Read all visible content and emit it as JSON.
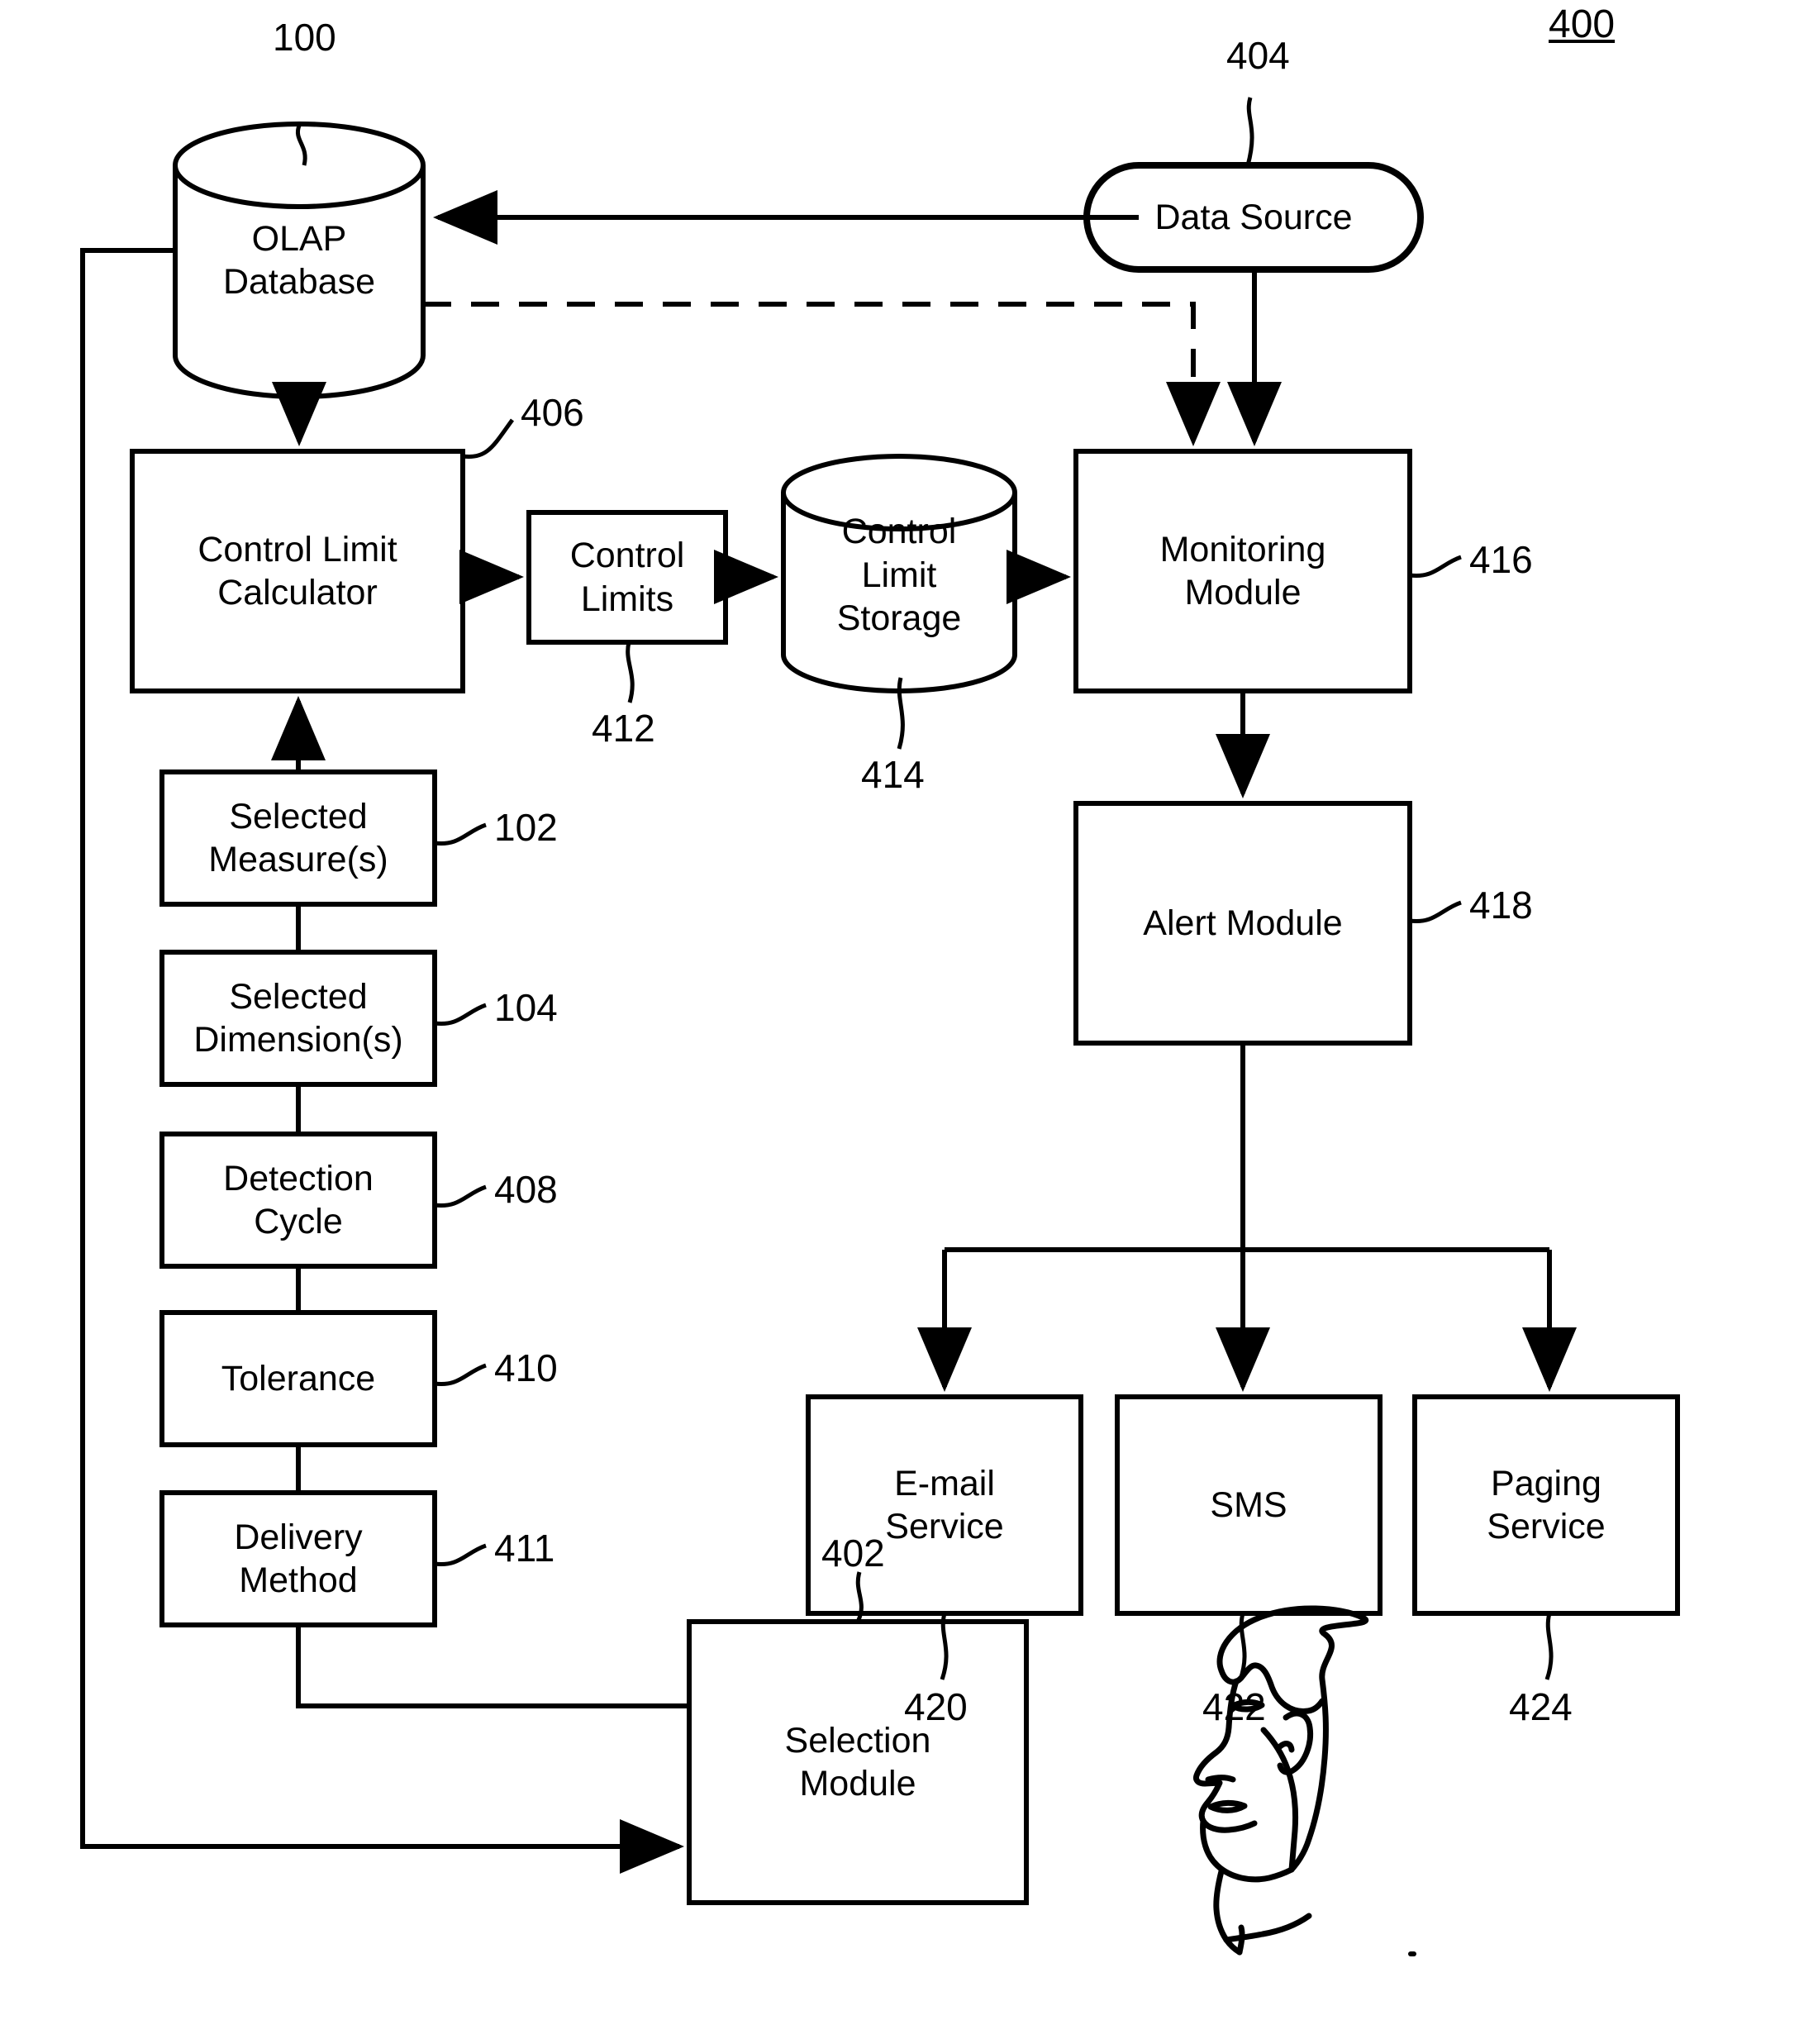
{
  "figure": {
    "number": "400",
    "kind": "patent-block-diagram"
  },
  "nodes": {
    "olap_database": {
      "label": "OLAP\nDatabase",
      "ref": "100",
      "shape": "cylinder"
    },
    "data_source": {
      "label": "Data Source",
      "ref": "404",
      "shape": "stadium"
    },
    "control_limit_calculator": {
      "label": "Control Limit\nCalculator",
      "ref": "406",
      "shape": "rect"
    },
    "control_limits": {
      "label": "Control\nLimits",
      "ref": "412",
      "shape": "rect"
    },
    "control_limit_storage": {
      "label": "Control\nLimit\nStorage",
      "ref": "414",
      "shape": "cylinder"
    },
    "monitoring_module": {
      "label": "Monitoring\nModule",
      "ref": "416",
      "shape": "rect"
    },
    "alert_module": {
      "label": "Alert Module",
      "ref": "418",
      "shape": "rect"
    },
    "selected_measures": {
      "label": "Selected\nMeasure(s)",
      "ref": "102",
      "shape": "rect"
    },
    "selected_dimensions": {
      "label": "Selected\nDimension(s)",
      "ref": "104",
      "shape": "rect"
    },
    "detection_cycle": {
      "label": "Detection\nCycle",
      "ref": "408",
      "shape": "rect"
    },
    "tolerance": {
      "label": "Tolerance",
      "ref": "410",
      "shape": "rect"
    },
    "delivery_method": {
      "label": "Delivery\nMethod",
      "ref": "411",
      "shape": "rect"
    },
    "email_service": {
      "label": "E-mail\nService",
      "ref": "420",
      "shape": "rect"
    },
    "sms": {
      "label": "SMS",
      "ref": "422",
      "shape": "rect"
    },
    "paging_service": {
      "label": "Paging\nService",
      "ref": "424",
      "shape": "rect"
    },
    "selection_module": {
      "label": "Selection\nModule",
      "ref": "402",
      "shape": "rect"
    },
    "user_head": {
      "label": "",
      "ref": "",
      "shape": "profile-illustration"
    }
  },
  "connections": [
    {
      "from": "data_source",
      "to": "olap_database",
      "style": "solid",
      "arrow": "to"
    },
    {
      "from": "olap_database",
      "to": "monitoring_module",
      "style": "dashed",
      "arrow": "to"
    },
    {
      "from": "data_source",
      "to": "monitoring_module",
      "style": "solid",
      "arrow": "to"
    },
    {
      "from": "olap_database",
      "to": "control_limit_calculator",
      "style": "solid",
      "arrow": "to"
    },
    {
      "from": "control_limit_calculator",
      "to": "control_limits",
      "style": "solid",
      "arrow": "to"
    },
    {
      "from": "control_limits",
      "to": "control_limit_storage",
      "style": "solid",
      "arrow": "to"
    },
    {
      "from": "control_limit_storage",
      "to": "monitoring_module",
      "style": "solid",
      "arrow": "to"
    },
    {
      "from": "monitoring_module",
      "to": "alert_module",
      "style": "solid",
      "arrow": "to"
    },
    {
      "from": "alert_module",
      "to": "email_service",
      "style": "solid",
      "arrow": "to"
    },
    {
      "from": "alert_module",
      "to": "sms",
      "style": "solid",
      "arrow": "to"
    },
    {
      "from": "alert_module",
      "to": "paging_service",
      "style": "solid",
      "arrow": "to"
    },
    {
      "from": "selected_measures",
      "to": "control_limit_calculator",
      "style": "solid",
      "arrow": "to"
    },
    {
      "from": "selected_measures",
      "to": "selected_dimensions",
      "style": "solid",
      "arrow": "none"
    },
    {
      "from": "selected_dimensions",
      "to": "detection_cycle",
      "style": "solid",
      "arrow": "none"
    },
    {
      "from": "detection_cycle",
      "to": "tolerance",
      "style": "solid",
      "arrow": "none"
    },
    {
      "from": "tolerance",
      "to": "delivery_method",
      "style": "solid",
      "arrow": "none"
    },
    {
      "from": "delivery_method",
      "to": "selection_module",
      "style": "solid",
      "arrow": "none"
    },
    {
      "from": "olap_database",
      "to": "selection_module",
      "style": "solid",
      "arrow": "to"
    }
  ]
}
